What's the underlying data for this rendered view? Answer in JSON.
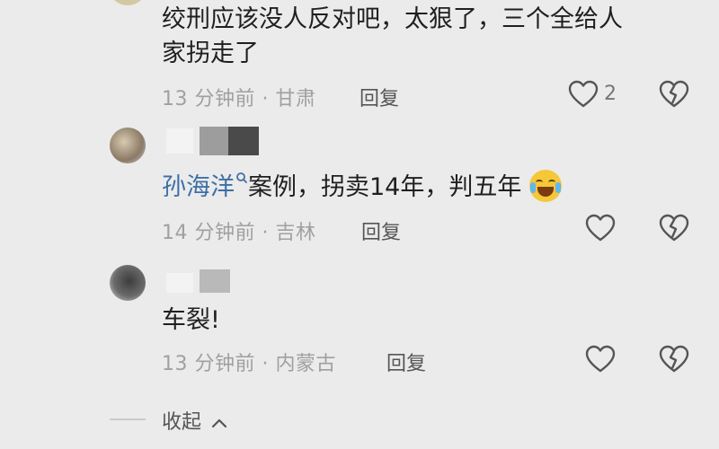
{
  "comments": [
    {
      "text_line1": "绞刑应该没人反对吧，太狠了，三个全给人",
      "text_line2": "家拐走了",
      "time": "13 分钟前",
      "location": "甘肃",
      "reply_label": "回复",
      "likes": "2"
    },
    {
      "mention": "孙海洋",
      "text": "案例，拐卖14年，判五年",
      "time": "14 分钟前",
      "location": "吉林",
      "reply_label": "回复"
    },
    {
      "text": "车裂!",
      "time": "13 分钟前",
      "location": "内蒙古",
      "reply_label": "回复"
    }
  ],
  "separator": "·",
  "collapse_label": "收起"
}
